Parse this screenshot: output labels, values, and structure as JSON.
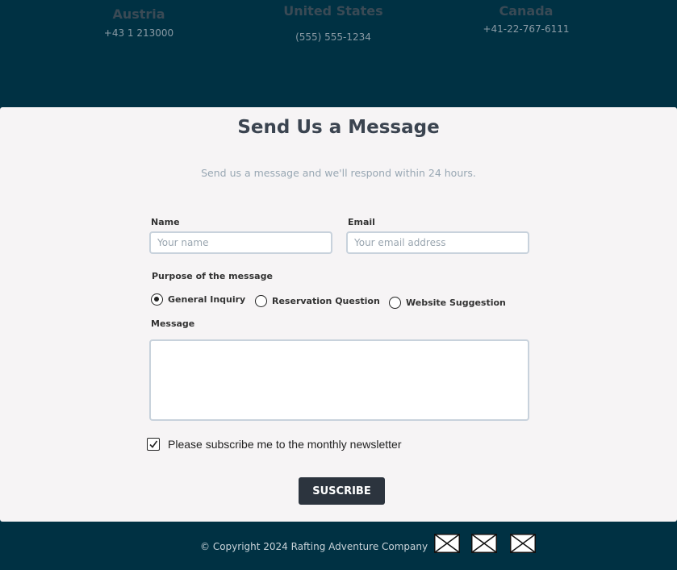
{
  "offices": [
    {
      "country": "Austria",
      "phone": "+43 1 213000"
    },
    {
      "country": "United States",
      "phone": "(555) 555-1234"
    },
    {
      "country": "Canada",
      "phone": "+41-22-767-6111"
    }
  ],
  "form": {
    "title": "Send Us a Message",
    "subtitle": "Send us a message and we'll respond within 24 hours.",
    "name_label": "Name",
    "name_placeholder": "Your name",
    "email_label": "Email",
    "email_placeholder": "Your email address",
    "purpose_label": "Purpose of the message",
    "purpose_options": [
      {
        "label": "General Inquiry",
        "selected": true
      },
      {
        "label": "Reservation Question",
        "selected": false
      },
      {
        "label": "Website Suggestion",
        "selected": false
      }
    ],
    "message_label": "Message",
    "message_value": "",
    "newsletter_label": "Please subscribe me to the monthly newsletter",
    "newsletter_checked": true,
    "submit_label": "SUSCRIBE"
  },
  "footer": {
    "copyright": "© Copyright 2024 Rafting Adventure Company",
    "social_icons": [
      "image-placeholder-icon",
      "image-placeholder-icon",
      "image-placeholder-icon"
    ]
  },
  "colors": {
    "dark_band": "#003143",
    "panel_bg": "#f6f4f5",
    "button_bg": "#2c343e",
    "input_border": "#c8d2dc"
  }
}
